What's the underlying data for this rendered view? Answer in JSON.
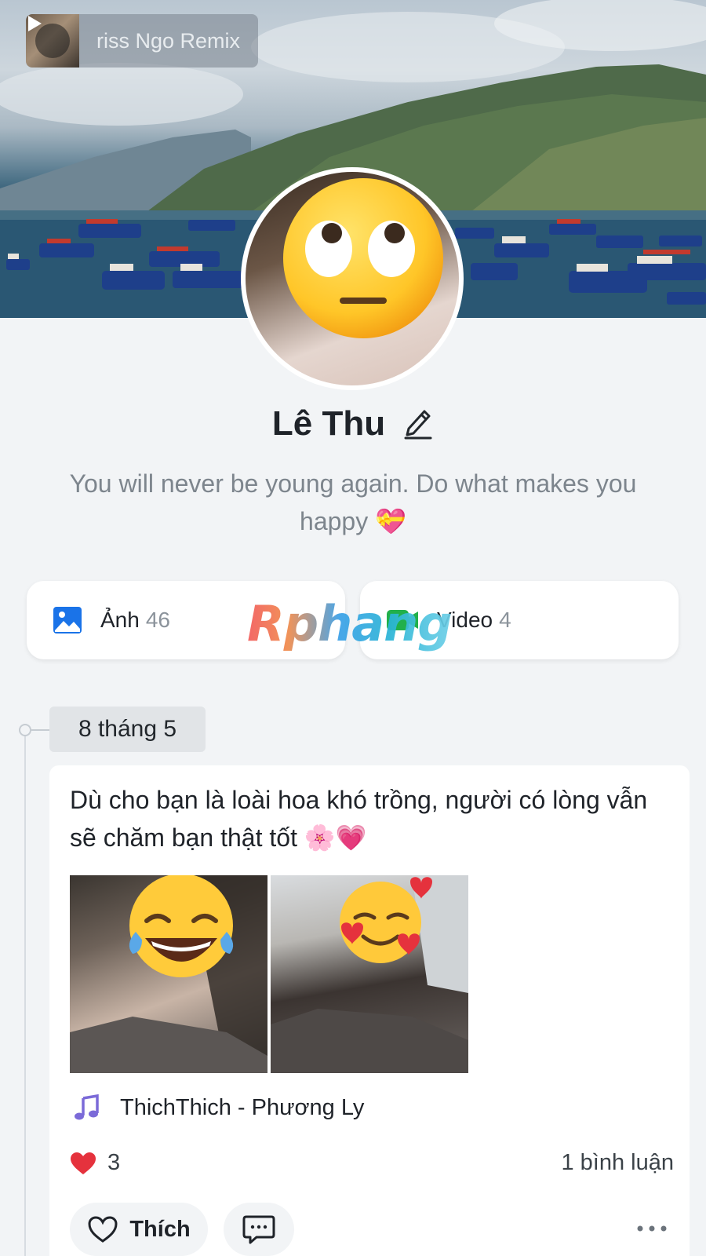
{
  "cover": {
    "music_title": "riss Ngo Remix"
  },
  "profile": {
    "name": "Lê Thu",
    "bio": "You will never be young again. Do what makes you happy 💝"
  },
  "media": {
    "photos_label": "Ảnh",
    "photos_count": "46",
    "videos_label": "Video",
    "videos_count": "4"
  },
  "watermark": "Rphang",
  "timeline": {
    "date": "8 tháng 5"
  },
  "post": {
    "text": "Dù cho bạn là loài hoa khó trồng, người có lòng vẫn sẽ chăm bạn thật tốt 🌸💗",
    "song": "ThichThich - Phương Ly",
    "likes": "3",
    "comments": "1 bình luận",
    "like_label": "Thích"
  },
  "colors": {
    "accent_blue": "#1a73e8",
    "video_green": "#21b04b",
    "heart_red": "#e5323d",
    "music_purple": "#7b6ad8"
  }
}
